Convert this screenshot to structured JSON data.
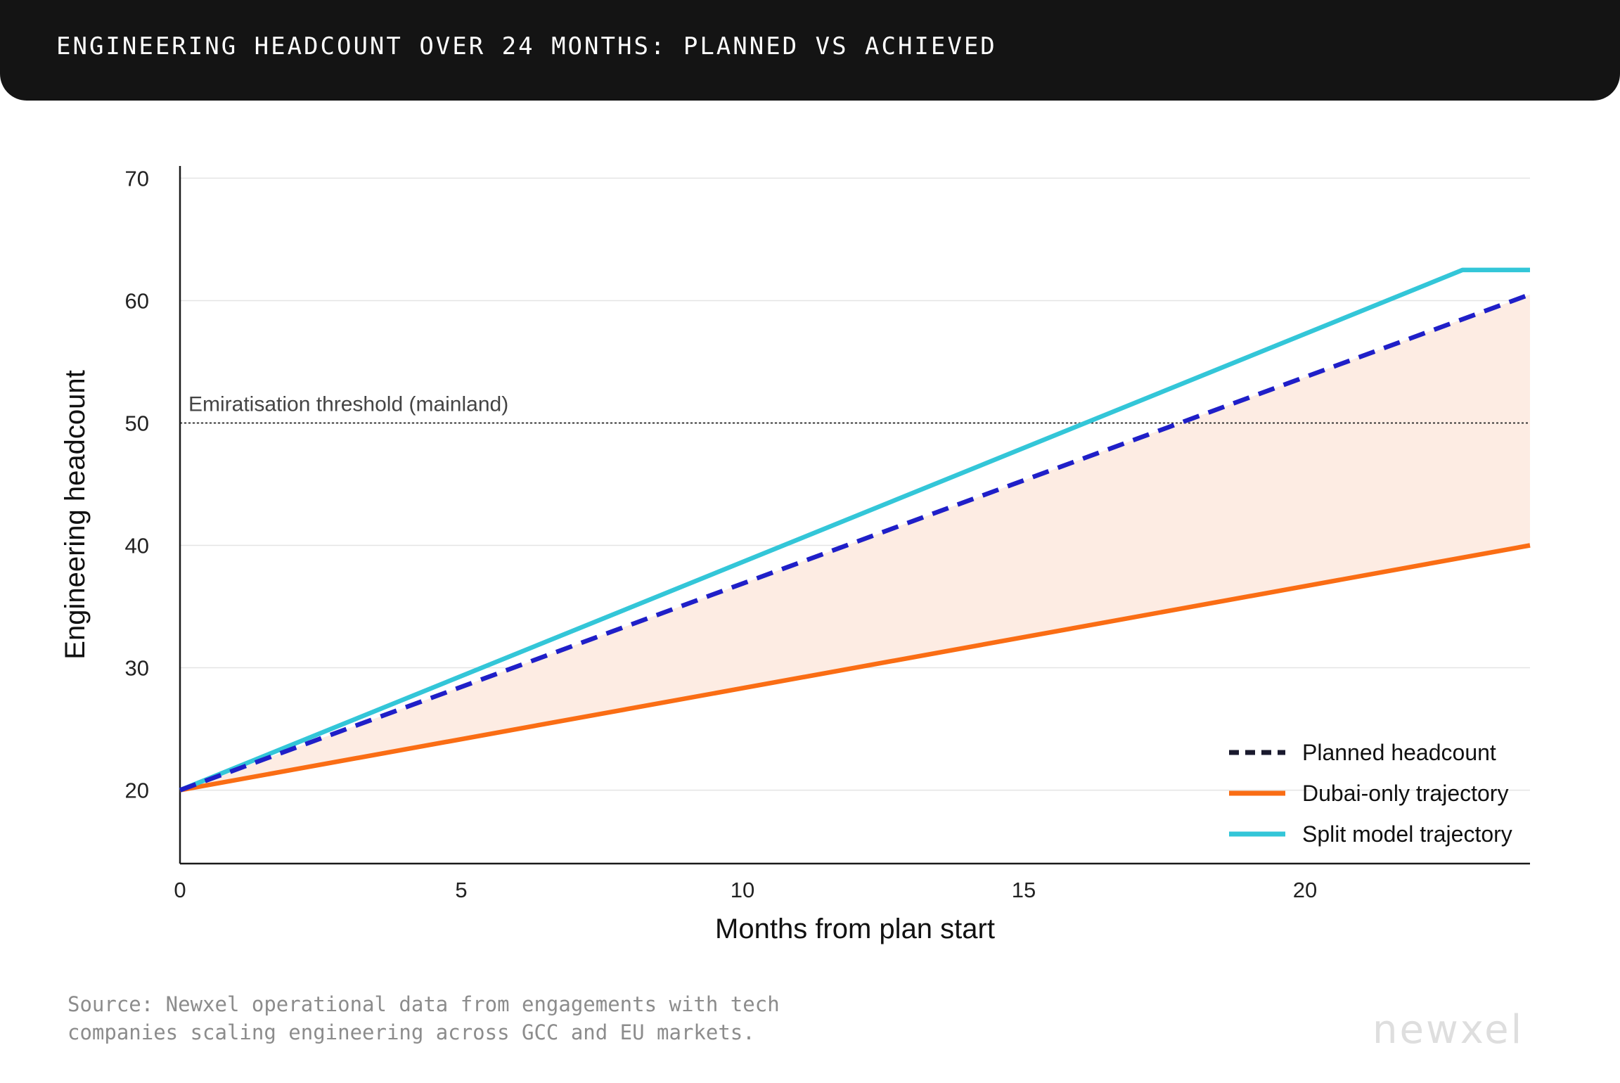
{
  "header": {
    "title": "ENGINEERING HEADCOUNT OVER 24 MONTHS: PLANNED VS ACHIEVED"
  },
  "chart_data": {
    "type": "line",
    "xlabel": "Months from plan start",
    "ylabel": "Engineering headcount",
    "xlim": [
      0,
      24
    ],
    "ylim": [
      14,
      71
    ],
    "xticks": [
      0,
      5,
      10,
      15,
      20
    ],
    "yticks": [
      20,
      30,
      40,
      50,
      60,
      70
    ],
    "grid": true,
    "legend": "bottom-right",
    "threshold": {
      "label": "Emiratisation threshold (mainland)",
      "y": 50
    },
    "shaded_between": [
      "Planned headcount",
      "Dubai-only trajectory"
    ],
    "series": [
      {
        "name": "Planned headcount",
        "style": "dashed",
        "color": "#1f1fc8",
        "x": [
          0,
          24
        ],
        "y": [
          20,
          60.5
        ]
      },
      {
        "name": "Dubai-only trajectory",
        "style": "solid",
        "color": "#fa6d14",
        "x": [
          0,
          24
        ],
        "y": [
          20,
          40
        ]
      },
      {
        "name": "Split model trajectory",
        "style": "solid",
        "color": "#33c6d8",
        "x": [
          0,
          22.8,
          24
        ],
        "y": [
          20,
          62.5,
          62.5
        ]
      }
    ]
  },
  "colors": {
    "shade": "#fdece3",
    "legend_planned_swatch": "#1a1a2e",
    "axis": "#1a1a1a",
    "grid": "#e4e4e4"
  },
  "footer": {
    "source_line1": "Source: Newxel operational data from engagements with tech",
    "source_line2": "companies scaling engineering across GCC and EU markets.",
    "logo": "newxel"
  }
}
